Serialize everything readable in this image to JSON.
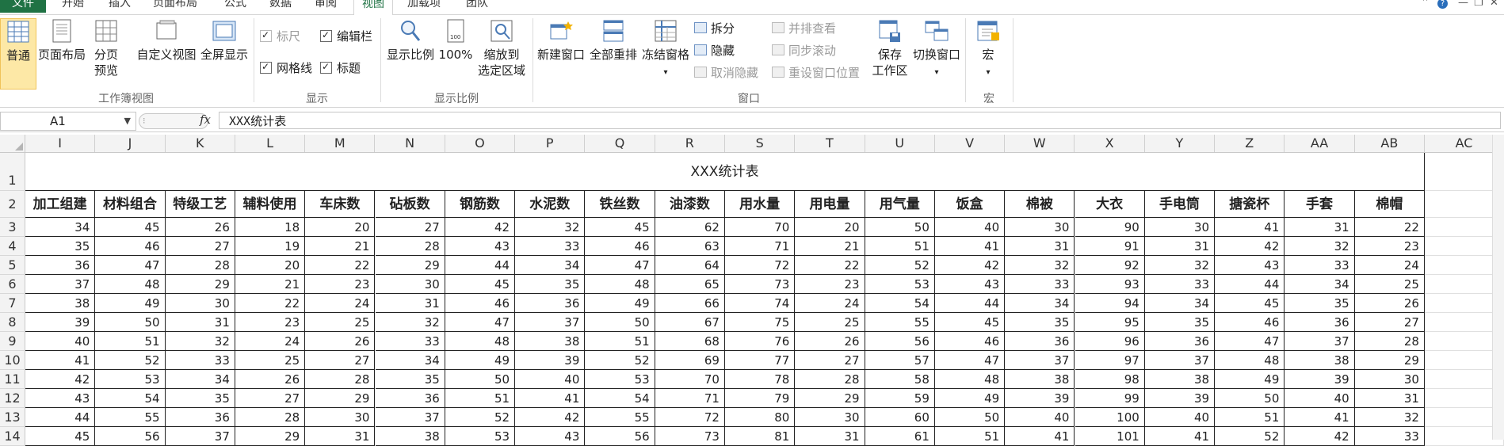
{
  "tabs": {
    "file": "文件",
    "items": [
      "开始",
      "插入",
      "页面布局",
      "公式",
      "数据",
      "审阅",
      "视图",
      "加载项",
      "团队"
    ],
    "active": "视图"
  },
  "window_controls": {
    "help": "?",
    "minimize": "—",
    "restore": "❐",
    "close": "✕"
  },
  "ribbon": {
    "workbook_views": {
      "label": "工作簿视图",
      "normal": "普通",
      "page_layout": "页面布局",
      "page_break_1": "分页",
      "page_break_2": "预览",
      "custom_view": "自定义视图",
      "full_screen": "全屏显示"
    },
    "show": {
      "label": "显示",
      "ruler": "标尺",
      "formula_bar": "编辑栏",
      "gridlines": "网格线",
      "headings": "标题"
    },
    "zoom": {
      "label": "显示比例",
      "zoom": "显示比例",
      "zoom_100": "100%",
      "zoom_sel_1": "缩放到",
      "zoom_sel_2": "选定区域"
    },
    "window": {
      "label": "窗口",
      "new_window": "新建窗口",
      "arrange_all": "全部重排",
      "freeze": "冻结窗格",
      "split": "拆分",
      "hide": "隐藏",
      "unhide": "取消隐藏",
      "side_by_side": "并排查看",
      "sync_scroll": "同步滚动",
      "reset_pos": "重设窗口位置",
      "save_ws_1": "保存",
      "save_ws_2": "工作区",
      "switch": "切换窗口"
    },
    "macros": {
      "label": "宏",
      "macro": "宏"
    }
  },
  "formula_bar": {
    "name_box": "A1",
    "fx": "fx",
    "content": "XXX统计表"
  },
  "sheet": {
    "columns": [
      "I",
      "J",
      "K",
      "L",
      "M",
      "N",
      "O",
      "P",
      "Q",
      "R",
      "S",
      "T",
      "U",
      "V",
      "W",
      "X",
      "Y",
      "Z",
      "AA",
      "AB",
      "AC"
    ],
    "title": "XXX统计表",
    "headers": [
      "加工组建",
      "材料组合",
      "特级工艺",
      "辅料使用",
      "车床数",
      "砧板数",
      "钢筋数",
      "水泥数",
      "铁丝数",
      "油漆数",
      "用水量",
      "用电量",
      "用气量",
      "饭盒",
      "棉被",
      "大衣",
      "手电筒",
      "搪瓷杯",
      "手套",
      "棉帽"
    ],
    "row_numbers": [
      "1",
      "2",
      "3",
      "4",
      "5",
      "6",
      "7",
      "8",
      "9",
      "10",
      "11",
      "12",
      "13",
      "14"
    ],
    "rows": [
      [
        "34",
        "45",
        "26",
        "18",
        "20",
        "27",
        "42",
        "32",
        "45",
        "62",
        "70",
        "20",
        "50",
        "40",
        "30",
        "90",
        "30",
        "41",
        "31",
        "22"
      ],
      [
        "35",
        "46",
        "27",
        "19",
        "21",
        "28",
        "43",
        "33",
        "46",
        "63",
        "71",
        "21",
        "51",
        "41",
        "31",
        "91",
        "31",
        "42",
        "32",
        "23"
      ],
      [
        "36",
        "47",
        "28",
        "20",
        "22",
        "29",
        "44",
        "34",
        "47",
        "64",
        "72",
        "22",
        "52",
        "42",
        "32",
        "92",
        "32",
        "43",
        "33",
        "24"
      ],
      [
        "37",
        "48",
        "29",
        "21",
        "23",
        "30",
        "45",
        "35",
        "48",
        "65",
        "73",
        "23",
        "53",
        "43",
        "33",
        "93",
        "33",
        "44",
        "34",
        "25"
      ],
      [
        "38",
        "49",
        "30",
        "22",
        "24",
        "31",
        "46",
        "36",
        "49",
        "66",
        "74",
        "24",
        "54",
        "44",
        "34",
        "94",
        "34",
        "45",
        "35",
        "26"
      ],
      [
        "39",
        "50",
        "31",
        "23",
        "25",
        "32",
        "47",
        "37",
        "50",
        "67",
        "75",
        "25",
        "55",
        "45",
        "35",
        "95",
        "35",
        "46",
        "36",
        "27"
      ],
      [
        "40",
        "51",
        "32",
        "24",
        "26",
        "33",
        "48",
        "38",
        "51",
        "68",
        "76",
        "26",
        "56",
        "46",
        "36",
        "96",
        "36",
        "47",
        "37",
        "28"
      ],
      [
        "41",
        "52",
        "33",
        "25",
        "27",
        "34",
        "49",
        "39",
        "52",
        "69",
        "77",
        "27",
        "57",
        "47",
        "37",
        "97",
        "37",
        "48",
        "38",
        "29"
      ],
      [
        "42",
        "53",
        "34",
        "26",
        "28",
        "35",
        "50",
        "40",
        "53",
        "70",
        "78",
        "28",
        "58",
        "48",
        "38",
        "98",
        "38",
        "49",
        "39",
        "30"
      ],
      [
        "43",
        "54",
        "35",
        "27",
        "29",
        "36",
        "51",
        "41",
        "54",
        "71",
        "79",
        "29",
        "59",
        "49",
        "39",
        "99",
        "39",
        "50",
        "40",
        "31"
      ],
      [
        "44",
        "55",
        "36",
        "28",
        "30",
        "37",
        "52",
        "42",
        "55",
        "72",
        "80",
        "30",
        "60",
        "50",
        "40",
        "100",
        "40",
        "51",
        "41",
        "32"
      ],
      [
        "45",
        "56",
        "37",
        "29",
        "31",
        "38",
        "53",
        "43",
        "56",
        "73",
        "81",
        "31",
        "61",
        "51",
        "41",
        "101",
        "41",
        "52",
        "42",
        "33"
      ]
    ]
  }
}
